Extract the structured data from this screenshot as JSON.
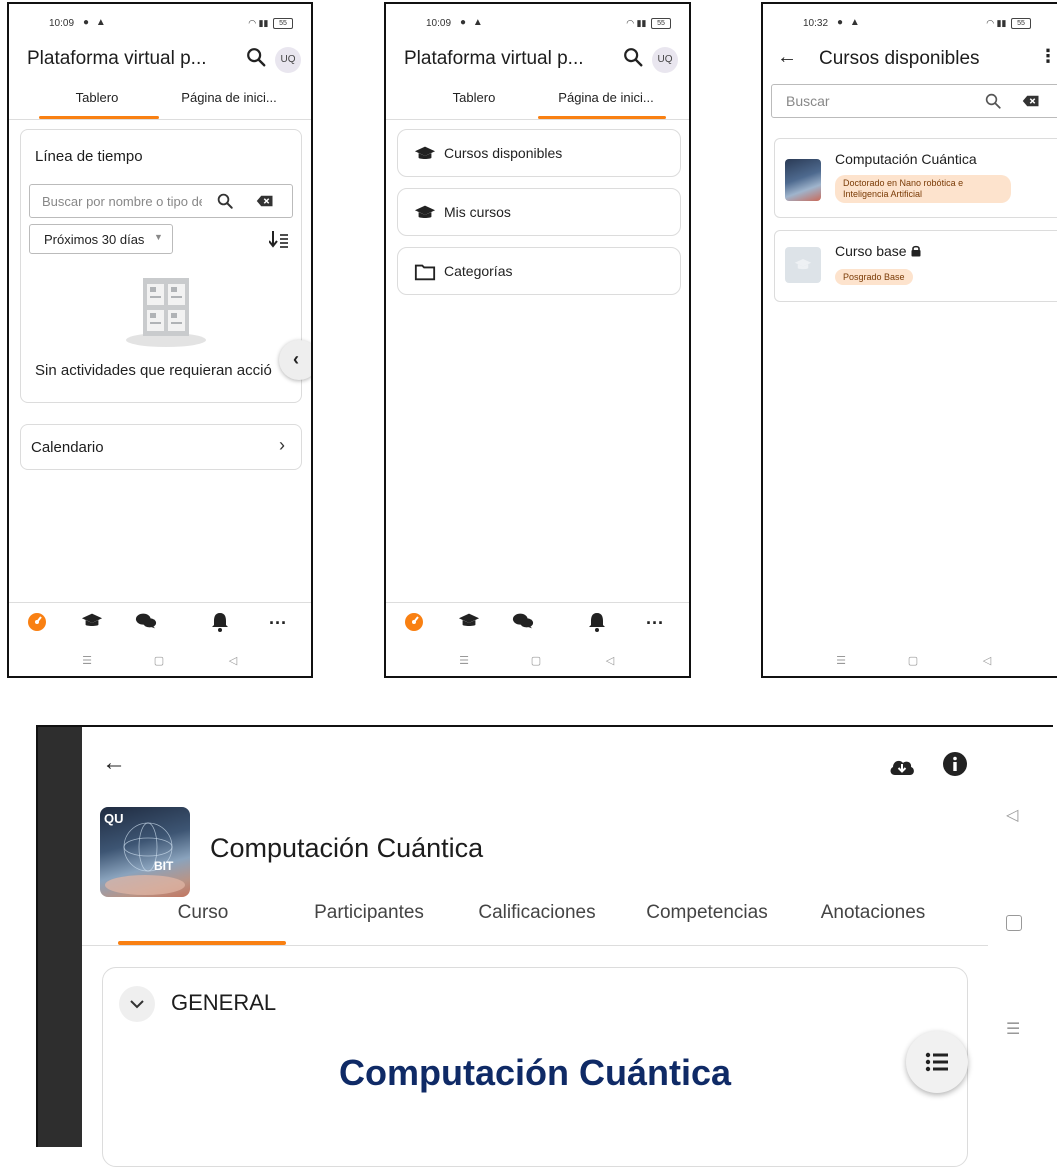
{
  "phone1": {
    "status_time": "10:09",
    "status_battery": "55",
    "title": "Plataforma virtual p...",
    "avatar": "UQ",
    "tabs": [
      "Tablero",
      "Página de inici..."
    ],
    "timeline_title": "Línea de tiempo",
    "search_placeholder": "Buscar por nombre o tipo de",
    "filter_value": "Próximos 30 días",
    "empty_text": "Sin actividades que requieran acció",
    "calendar_label": "Calendario"
  },
  "phone2": {
    "status_time": "10:09",
    "status_battery": "55",
    "title": "Plataforma virtual p...",
    "avatar": "UQ",
    "tabs": [
      "Tablero",
      "Página de inici..."
    ],
    "items": [
      "Cursos disponibles",
      "Mis cursos",
      "Categorías"
    ]
  },
  "phone3": {
    "status_time": "10:32",
    "status_battery": "55",
    "title": "Cursos disponibles",
    "search_placeholder": "Buscar",
    "courses": [
      {
        "name": "Computación Cuántica",
        "badge": "Doctorado en Nano robótica e Inteligencia Artificial"
      },
      {
        "name": "Curso base",
        "badge": "Posgrado Base"
      }
    ]
  },
  "tablet": {
    "course_title": "Computación Cuántica",
    "thumb_text_top": "QU",
    "thumb_text_bottom": "BIT",
    "tabs": [
      "Curso",
      "Participantes",
      "Calificaciones",
      "Competencias",
      "Anotaciones"
    ],
    "section_label": "GENERAL",
    "heading": "Computación Cuántica"
  },
  "colors": {
    "accent": "#f98012",
    "badge_bg": "#fde3cd",
    "heading_blue": "#0f2a66",
    "sidebar_dark": "#2e2e2e"
  }
}
